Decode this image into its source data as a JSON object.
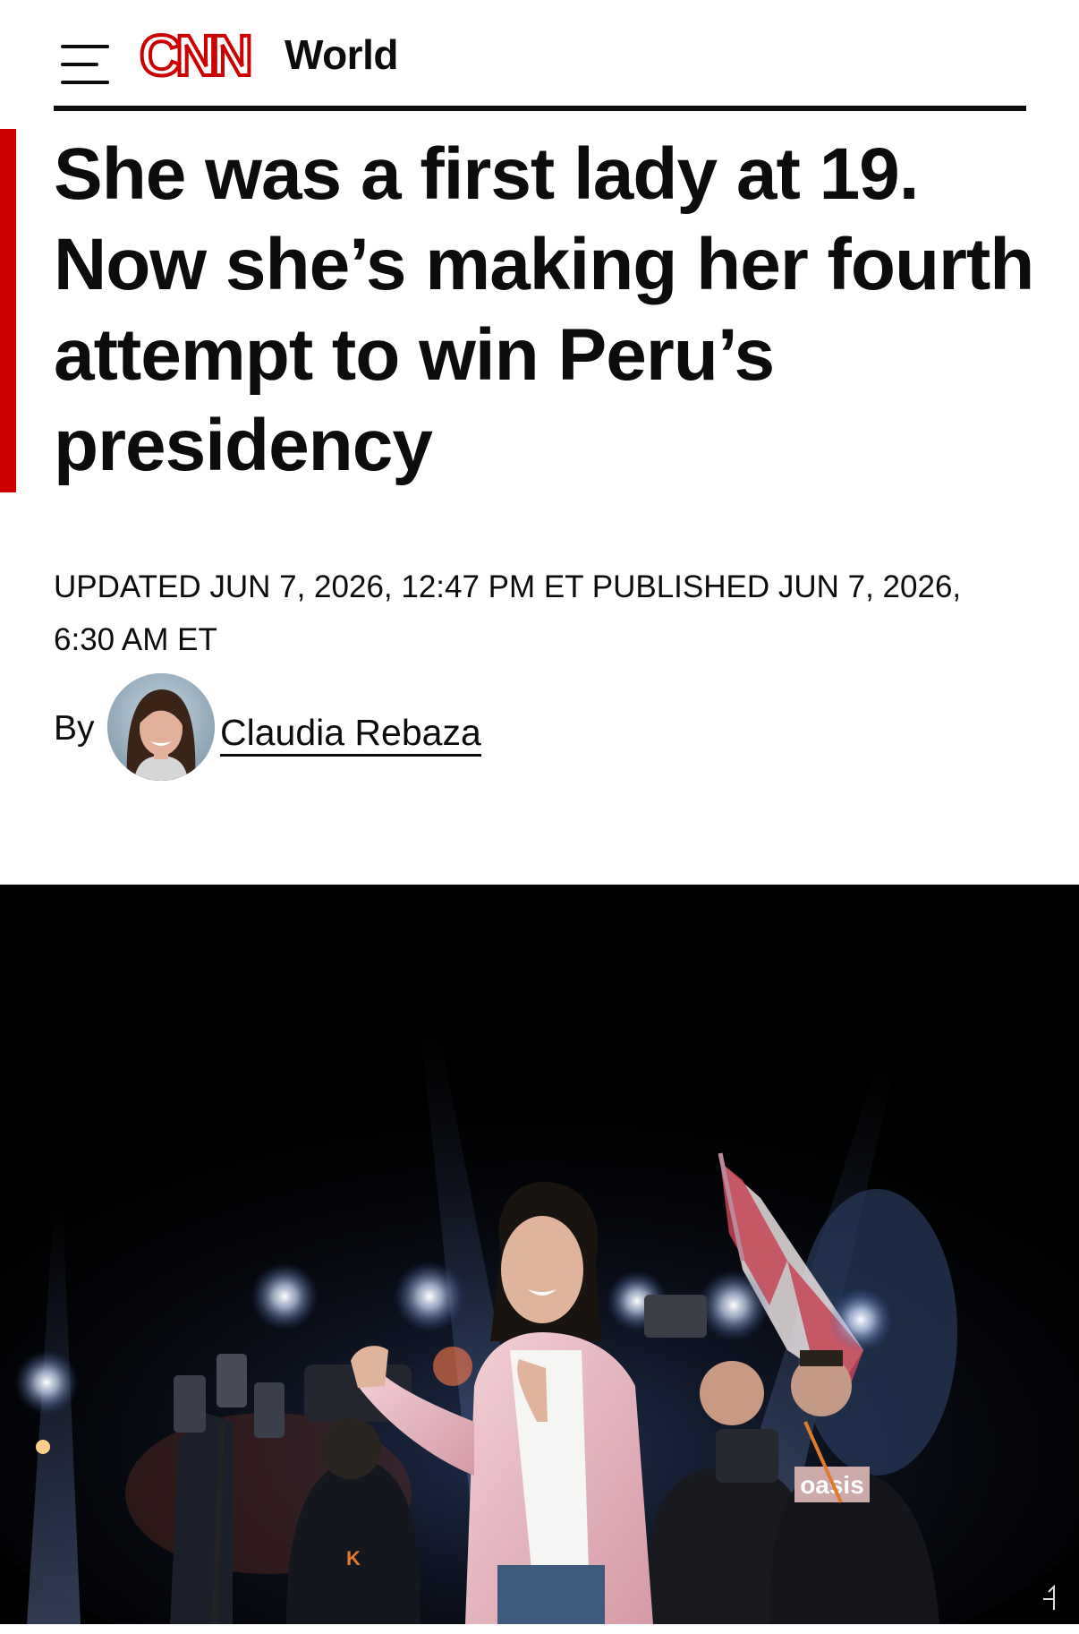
{
  "header": {
    "logo_text": "CNN",
    "section": "World",
    "brand_color": "#cc0000"
  },
  "article": {
    "headline": "She was a first lady at 19. Now she’s making her fourth attempt to win Peru’s presidency",
    "updated": "UPDATED JUN 7, 2026, 12:47 PM ET",
    "published": "PUBLISHED JUN 7, 2026, 6:30 AM ET",
    "by_label": "By",
    "author": "Claudia Rebaza"
  },
  "hero_image": {
    "shirt_text": "oasis",
    "badge_letter": "K"
  }
}
